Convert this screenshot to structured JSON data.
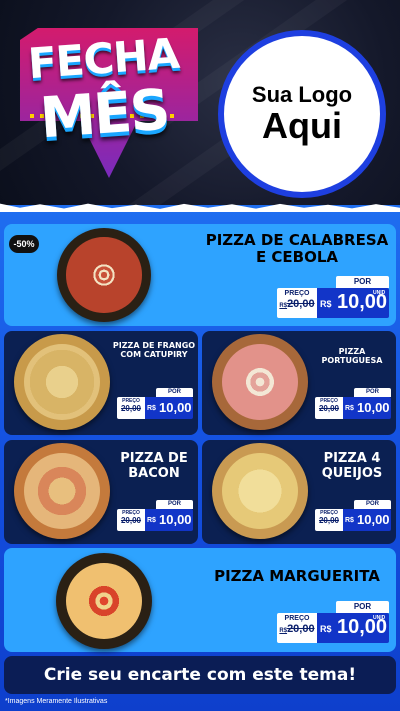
{
  "hero": {
    "title_line1": "FECHA",
    "title_line2": "MÊS",
    "logo_line1": "Sua Logo",
    "logo_line2": "Aqui"
  },
  "discount_badge": "-50%",
  "price_labels": {
    "por": "POR",
    "preco": "PREÇO",
    "de_prefix": "R$",
    "old": "20,00",
    "currency": "R$",
    "new": "10,00",
    "unit": "UNID"
  },
  "products": [
    {
      "name": "PIZZA DE CALABRESA E CEBOLA"
    },
    {
      "name": "PIZZA DE FRANGO COM CATUPIRY"
    },
    {
      "name": "PIZZA PORTUGUESA"
    },
    {
      "name": "PIZZA DE BACON"
    },
    {
      "name": "PIZZA 4 QUEIJOS"
    },
    {
      "name": "PIZZA MARGUERITA"
    }
  ],
  "cta": "Crie seu encarte com este tema!",
  "footnote": "*Imagens Meramente Ilustrativas",
  "colors": {
    "brand_blue": "#1f6ef0",
    "card_light": "#2ea3ff",
    "card_dark": "#0b2052",
    "price_blue": "#1235c8"
  }
}
